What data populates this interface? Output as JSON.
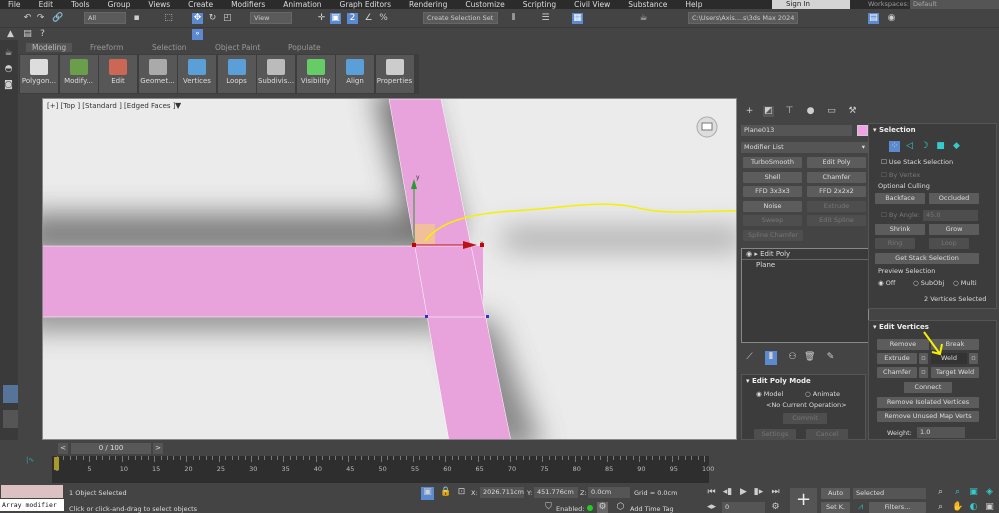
{
  "menu": [
    "File",
    "Edit",
    "Tools",
    "Group",
    "Views",
    "Create",
    "Modifiers",
    "Animation",
    "Graph Editors",
    "Rendering",
    "Customize",
    "Scripting",
    "Civil View",
    "Substance",
    "Help"
  ],
  "toolbar": {
    "selection_filter": "All",
    "ref_coord": "View",
    "selection_set": "Create Selection Set",
    "project_path": "C:\\Users\\Axis....s\\3ds Max 2024",
    "sign_in": "Sign In",
    "workspaces_label": "Workspaces:",
    "workspace": "Default"
  },
  "ribbon": {
    "tabs": [
      "Modeling",
      "Freeform",
      "Selection",
      "Object Paint",
      "Populate"
    ],
    "buttons": [
      "Polygon...",
      "Modify...",
      "Edit",
      "Geomet...",
      "Vertices",
      "Loops",
      "Subdivis...",
      "Visibility",
      "Align",
      "Properties"
    ]
  },
  "viewport": {
    "label": "[+] [Top ] [Standard ] [Edged Faces ]",
    "axis_x": "x",
    "axis_y": "y",
    "object_color": "#e8a3dd",
    "annotation_color": "#f5f000"
  },
  "panel": {
    "object_name": "Plane013",
    "object_color": "#f3a0e6",
    "modifier_list": "Modifier List",
    "modifier_buttons": [
      {
        "label": "TurboSmooth",
        "enabled": true
      },
      {
        "label": "Edit Poly",
        "enabled": true
      },
      {
        "label": "Shell",
        "enabled": true
      },
      {
        "label": "Chamfer",
        "enabled": true
      },
      {
        "label": "FFD 3x3x3",
        "enabled": true
      },
      {
        "label": "FFD 2x2x2",
        "enabled": true
      },
      {
        "label": "Noise",
        "enabled": true
      },
      {
        "label": "Extrude",
        "enabled": false
      },
      {
        "label": "Sweep",
        "enabled": false
      },
      {
        "label": "Edit Spline",
        "enabled": false
      },
      {
        "label": "Spline Chamfer",
        "enabled": false
      }
    ],
    "stack": [
      "Edit Poly",
      "Plane"
    ],
    "edit_poly_mode": {
      "title": "Edit Poly Mode",
      "model": "Model",
      "animate": "Animate",
      "operation": "<No Current Operation>",
      "commit": "Commit",
      "settings": "Settings",
      "cancel": "Cancel"
    },
    "selection": {
      "title": "Selection",
      "use_stack": "Use Stack Selection",
      "by_vertex": "By Vertex",
      "optional_culling": "Optional Culling",
      "backface": "Backface",
      "occluded": "Occluded",
      "by_angle": "By Angle:",
      "angle": "45.0",
      "shrink": "Shrink",
      "grow": "Grow",
      "ring": "Ring",
      "loop": "Loop",
      "get_stack": "Get Stack Selection",
      "preview": "Preview Selection",
      "off": "Off",
      "subobj": "SubObj",
      "multi": "Multi",
      "status": "2 Vertices Selected"
    },
    "edit_vertices": {
      "title": "Edit Vertices",
      "remove": "Remove",
      "break": "Break",
      "extrude": "Extrude",
      "weld": "Weld",
      "chamfer": "Chamfer",
      "target_weld": "Target Weld",
      "connect": "Connect",
      "remove_isolated": "Remove Isolated Vertices",
      "remove_unused": "Remove Unused Map Verts",
      "weight_label": "Weight:",
      "weight": "1.0"
    }
  },
  "timeline": {
    "frame": "0 / 100",
    "ticks": [
      "0",
      "5",
      "10",
      "15",
      "20",
      "25",
      "30",
      "35",
      "40",
      "45",
      "50",
      "55",
      "60",
      "65",
      "70",
      "75",
      "80",
      "85",
      "90",
      "95",
      "100"
    ]
  },
  "status": {
    "maxscript": "Array modifier",
    "selected": "1 Object Selected",
    "prompt": "Click or click-and-drag to select objects",
    "x_label": "X:",
    "x": "2026.711cm",
    "y_label": "Y:",
    "y": "451.776cm",
    "z_label": "Z:",
    "z": "0.0cm",
    "grid": "Grid = 0.0cm",
    "enabled": "Enabled:",
    "add_time_tag": "Add Time Tag",
    "frame": "0",
    "auto": "Auto",
    "set_key": "Set K.",
    "key_filter": "Selected",
    "filters": "Filters..."
  }
}
